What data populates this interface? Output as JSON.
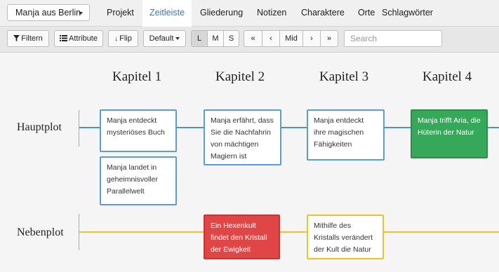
{
  "topnav": {
    "project": "Manja aus Berlin",
    "tabs": [
      "Projekt",
      "Zeitleiste",
      "Gliederung",
      "Notizen",
      "Charaktere",
      "Orte",
      "Schlagwörter"
    ],
    "active_tab": "Zeitleiste"
  },
  "toolbar": {
    "filter_label": "Filtern",
    "attribute_label": "Attribute",
    "flip_label": "Flip",
    "default_label": "Default",
    "sizes": [
      "L",
      "M",
      "S"
    ],
    "active_size": "L",
    "nav": [
      "«",
      "‹",
      "Mid",
      "›",
      "»"
    ],
    "search_placeholder": "Search"
  },
  "timeline": {
    "chapters": [
      "Kapitel 1",
      "Kapitel 2",
      "Kapitel 3",
      "Kapitel 4"
    ],
    "plotlines": [
      {
        "name": "Hauptplot",
        "color": "#4a90d9",
        "cards": [
          {
            "chapter": 1,
            "text": "Manja entdeckt mysteriöses Buch",
            "style": "default"
          },
          {
            "chapter": 1,
            "text": "Manja landet in geheimnisvoller Parallelwelt",
            "style": "default"
          },
          {
            "chapter": 2,
            "text": "Manja erfährt, dass Sie die Nachfahrin von mächtigen Magiern ist",
            "style": "default"
          },
          {
            "chapter": 3,
            "text": "Manja entdeckt ihre magischen Fähigkeiten",
            "style": "default"
          },
          {
            "chapter": 4,
            "text": "Manja trifft Aria, die Hüterin der Natur",
            "style": "green"
          }
        ]
      },
      {
        "name": "Nebenplot",
        "color": "#f0c22a",
        "cards": [
          {
            "chapter": 2,
            "text": "Ein Hexenkult findet den Kristall der Ewigkeit",
            "style": "red"
          },
          {
            "chapter": 3,
            "text": "Mithilfe des Kristalls verändert der Kult die Natur",
            "style": "yellow"
          }
        ]
      }
    ]
  }
}
